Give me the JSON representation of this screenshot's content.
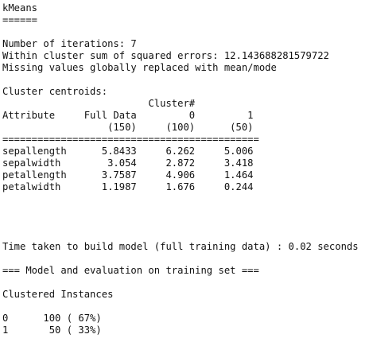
{
  "output": {
    "lines": [
      "kMeans",
      "======",
      "",
      "Number of iterations: 7",
      "Within cluster sum of squared errors: 12.143688281579722",
      "Missing values globally replaced with mean/mode",
      "",
      "Cluster centroids:",
      "                         Cluster#",
      "Attribute     Full Data         0         1",
      "                  (150)     (100)      (50)",
      "============================================",
      "sepallength      5.8433     6.262     5.006",
      "sepalwidth        3.054     2.872     3.418",
      "petallength      3.7587     4.906     1.464",
      "petalwidth       1.1987     1.676     0.244",
      "",
      "",
      "",
      "",
      "Time taken to build model (full training data) : 0.02 seconds",
      "",
      "=== Model and evaluation on training set ===",
      "",
      "Clustered Instances",
      "",
      "0      100 ( 67%)",
      "1       50 ( 33%)"
    ]
  }
}
